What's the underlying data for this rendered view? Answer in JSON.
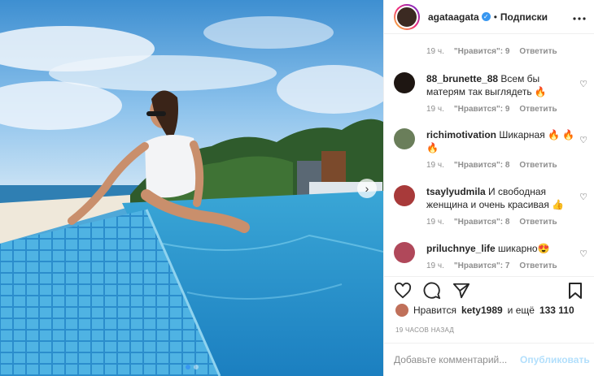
{
  "post": {
    "username": "agataagata",
    "verified_glyph": "✓",
    "separator": "•",
    "follow_state": "Подписки",
    "more_icon": "more-horizontal-icon"
  },
  "first_meta": {
    "time": "19 ч.",
    "likes": "\"Нравится\": 9",
    "reply": "Ответить"
  },
  "comments": [
    {
      "username": "88_brunette_88",
      "text": "Всем бы матерям так выглядеть",
      "emoji": "🔥",
      "time": "19 ч.",
      "likes": "\"Нравится\": 9",
      "reply": "Ответить",
      "avatar_color": "#1e1612"
    },
    {
      "username": "richimotivation",
      "text": "Шикарная",
      "emoji": "🔥 🔥 🔥",
      "time": "19 ч.",
      "likes": "\"Нравится\": 8",
      "reply": "Ответить",
      "avatar_color": "#6a7e5a"
    },
    {
      "username": "tsaylyudmila",
      "text": "И свободная женщина и очень красивая",
      "emoji": "👍",
      "time": "19 ч.",
      "likes": "\"Нравится\": 8",
      "reply": "Ответить",
      "avatar_color": "#a83a3a"
    },
    {
      "username": "priluсhnye_life",
      "text": "шикарно",
      "emoji": "😍",
      "time": "19 ч.",
      "likes": "\"Нравится\": 7",
      "reply": "Ответить",
      "avatar_color": "#b0485a"
    }
  ],
  "likes": {
    "prefix": "Нравится",
    "user": "kety1989",
    "middle": "и ещё",
    "count": "133 110"
  },
  "timestamp": "19 ЧАСОВ НАЗАД",
  "comment_box": {
    "placeholder": "Добавьте комментарий...",
    "publish": "Опубликовать"
  },
  "colors": {
    "accent": "#3897f0",
    "publish_disabled": "#b2dffc",
    "muted": "#8e8e8e"
  }
}
